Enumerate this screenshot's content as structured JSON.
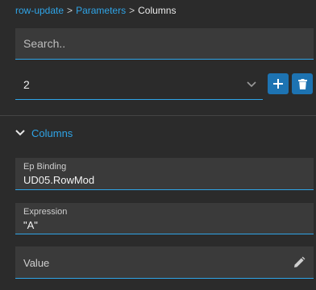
{
  "breadcrumb": {
    "items": [
      "row-update",
      "Parameters",
      "Columns"
    ],
    "separator": ">"
  },
  "search": {
    "placeholder": "Search.."
  },
  "row_selector": {
    "value": "2"
  },
  "section": {
    "title": "Columns",
    "expanded": true
  },
  "fields": {
    "ep_binding": {
      "label": "Ep Binding",
      "value": "UD05.RowMod"
    },
    "expression": {
      "label": "Expression",
      "value": "\"A\""
    },
    "value": {
      "placeholder": "Value"
    }
  },
  "icons": {
    "add": "plus-icon",
    "delete": "trash-icon",
    "dropdown": "chevron-down-icon",
    "section": "chevron-down-icon",
    "edit": "pencil-icon"
  },
  "colors": {
    "accent": "#2fa4e7",
    "button": "#1d73b2",
    "background": "#2b2b2b",
    "field_bg": "#3a3a3a"
  }
}
